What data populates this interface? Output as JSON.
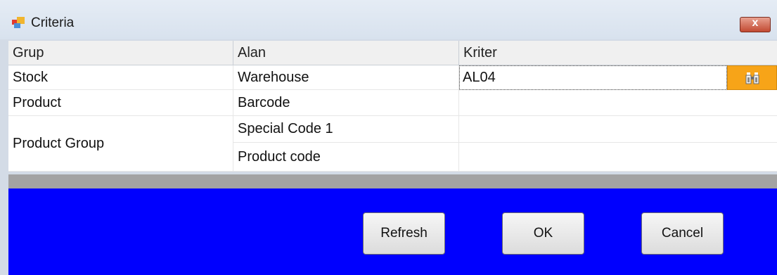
{
  "window": {
    "title": "Criteria",
    "close_label": "x"
  },
  "grid": {
    "headers": [
      "Grup",
      "Alan",
      "Kriter"
    ],
    "groups": [
      "Stock",
      "Product",
      "Product Group"
    ],
    "fields": [
      "Warehouse",
      "Barcode",
      "Special Code 1",
      "Product code"
    ],
    "criteria": {
      "warehouse_value": "AL04",
      "lookup_icon": "binoculars-icon",
      "lookup_color": "#f7a418"
    }
  },
  "buttons": {
    "refresh": "Refresh",
    "ok": "OK",
    "cancel": "Cancel"
  },
  "colors": {
    "bottom_panel": "#0000fe",
    "separator": "#a3a3a3",
    "close_button": "#c24a32"
  }
}
